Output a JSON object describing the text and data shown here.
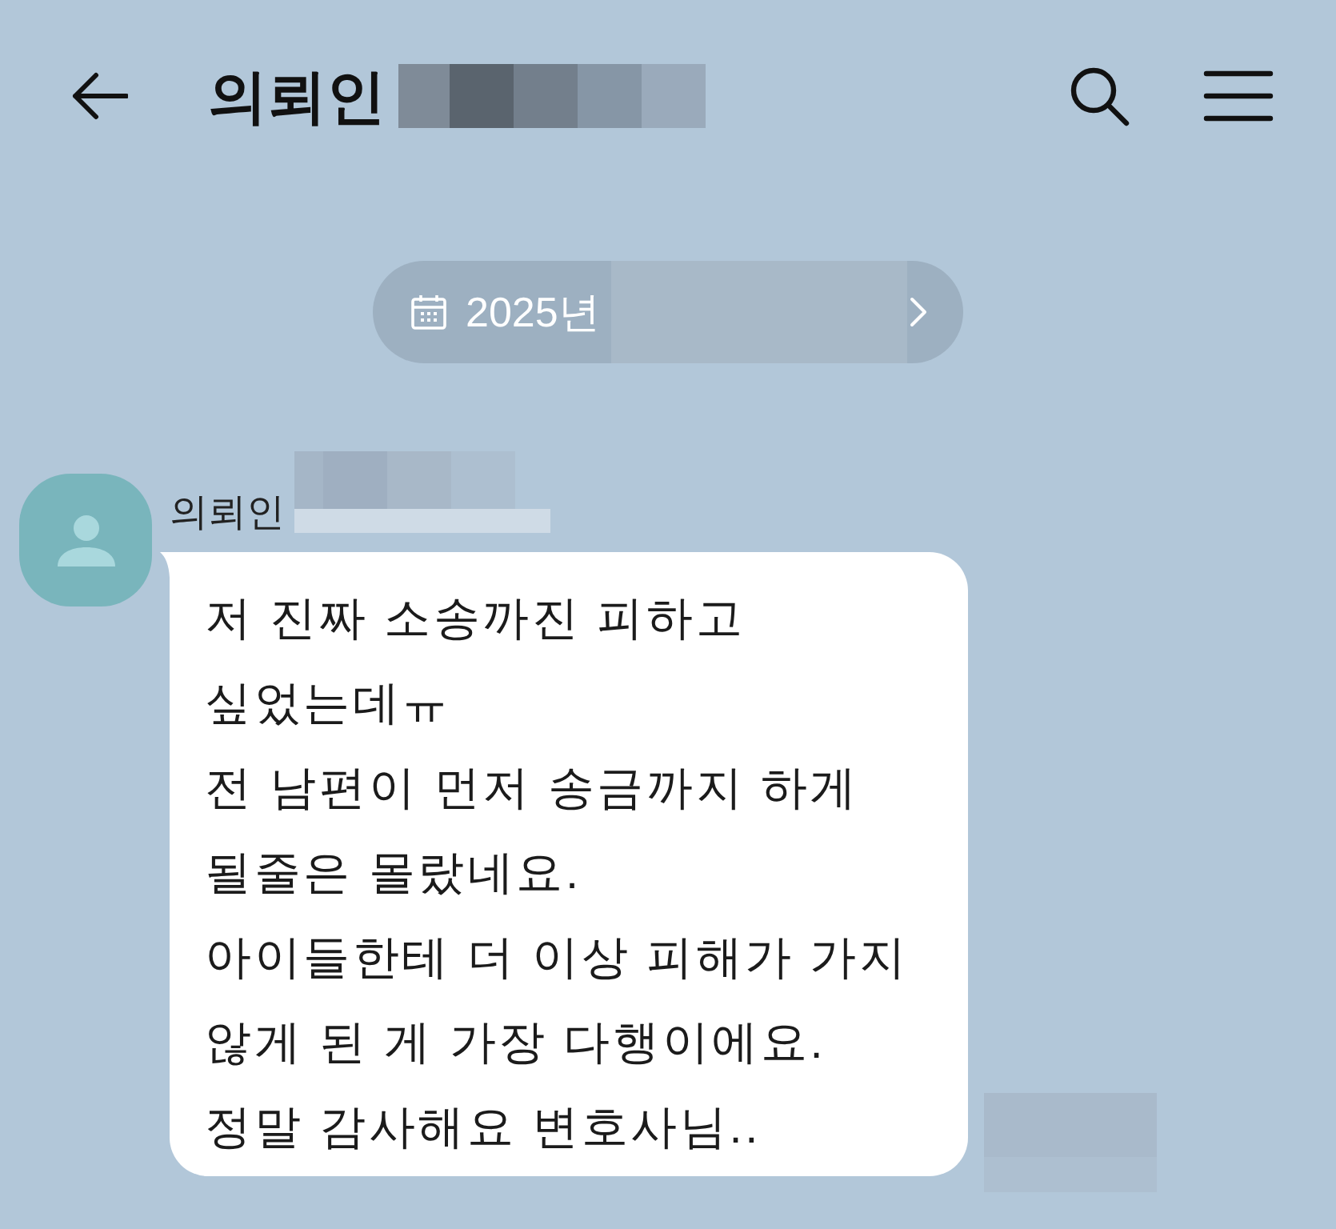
{
  "header": {
    "title": "의뢰인",
    "title_redacted": true
  },
  "date_divider": {
    "text": "2025년",
    "redacted": true
  },
  "messages": [
    {
      "sender": "의뢰인",
      "sender_redacted": true,
      "text": "저 진짜 소송까진 피하고\n싶었는데ㅠ\n전 남편이 먼저 송금까지 하게\n될줄은 몰랐네요.\n아이들한테 더 이상 피해가 가지\n않게 된 게 가장 다행이에요.\n정말 감사해요 변호사님..",
      "timestamp_redacted": true
    }
  ]
}
